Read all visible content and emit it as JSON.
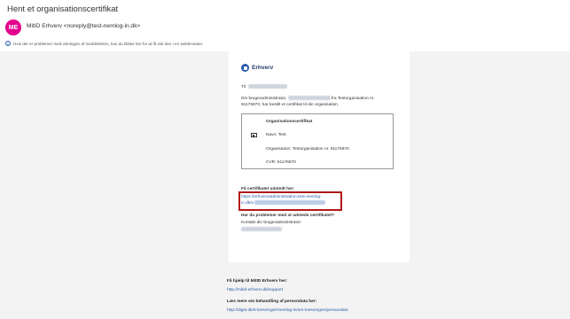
{
  "email": {
    "subject": "Hent et organisationscertifikat",
    "avatar_initials": "ME",
    "sender": "MitID Erhverv <noreply@test-nemlog-in.dk>",
    "notice": "Hvis der er problemer med visningen af meddelelsen, kan du klikke her for at få vist den i en webbrowser."
  },
  "body": {
    "brand": "Erhverv",
    "to_label": "Til",
    "greeting_prefix": "Din brugeradministrator,",
    "greeting_suffix": "fra Testorganisation nr.",
    "greeting_line2": "91176870, har bestilt et certifikat til din organisation.",
    "cert": {
      "title": "Organisationscertifikat",
      "name": "Navn: Test",
      "organisation": "Organisation: Testorganisation nr. 91176870",
      "cvr": "CVR: 91176870"
    },
    "link_heading": "Få certifikatet udstedt her:",
    "link_line1": "https://erhvervsadministration.test-nemlog-",
    "link_line2": "in.dk/u",
    "problem_heading": "Har du problemer med at udstede certifikatet?",
    "contact": "Kontakt din brugeradministrator:"
  },
  "footer": {
    "help_heading": "Få hjælp til MitID Erhverv her:",
    "help_link": "http://mitid-erhverv.dk/support",
    "privacy_heading": "Læs mere om behandling af persondata her:",
    "privacy_link": "http://digst.dk/it-loesninger/nemlog-in/om-loesningen/persondata"
  },
  "colors": {
    "accent": "#e3008c",
    "link": "#2a5aa8",
    "highlight": "#b01919"
  }
}
